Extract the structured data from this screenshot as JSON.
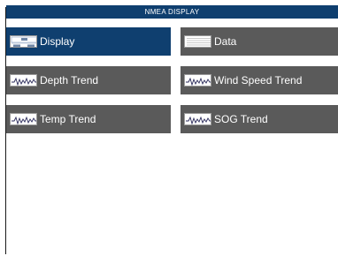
{
  "title": "NMEA DISPLAY",
  "menu": [
    {
      "label": "Display",
      "icon": "display-panel-icon",
      "selected": true
    },
    {
      "label": "Data",
      "icon": "data-table-icon",
      "selected": false
    },
    {
      "label": "Depth Trend",
      "icon": "trend-graph-icon",
      "selected": false
    },
    {
      "label": "Wind Speed Trend",
      "icon": "trend-graph-icon",
      "selected": false
    },
    {
      "label": "Temp Trend",
      "icon": "trend-graph-icon",
      "selected": false
    },
    {
      "label": "SOG Trend",
      "icon": "trend-graph-icon",
      "selected": false
    }
  ],
  "colors": {
    "title_bg": "#0f3f6f",
    "selected_bg": "#0f3f6f",
    "button_bg": "#5a5a5a",
    "text": "#ffffff"
  }
}
